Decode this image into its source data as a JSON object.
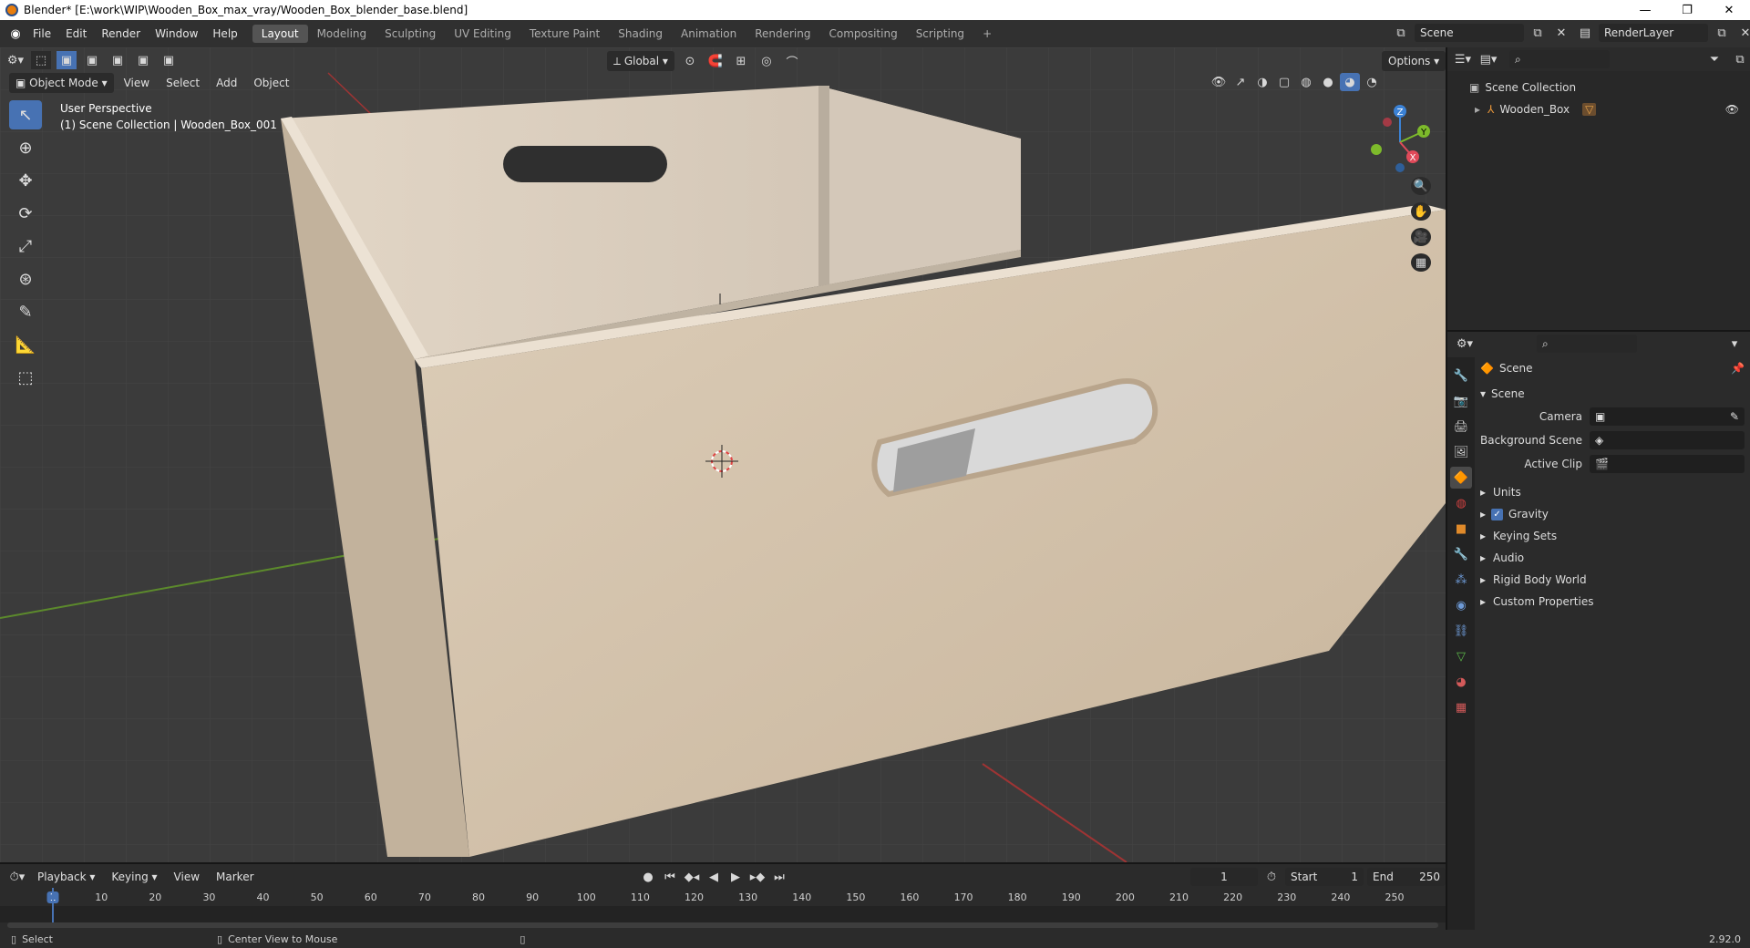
{
  "window": {
    "title": "Blender* [E:\\work\\WIP\\Wooden_Box_max_vray/Wooden_Box_blender_base.blend]",
    "min": "—",
    "max": "❐",
    "close": "✕"
  },
  "menu": [
    "File",
    "Edit",
    "Render",
    "Window",
    "Help"
  ],
  "workspaces": [
    "Layout",
    "Modeling",
    "Sculpting",
    "UV Editing",
    "Texture Paint",
    "Shading",
    "Animation",
    "Rendering",
    "Compositing",
    "Scripting"
  ],
  "active_workspace": "Layout",
  "scene_name": "Scene",
  "render_layer": "RenderLayer",
  "viewport": {
    "mode": "Object Mode",
    "menus": [
      "View",
      "Select",
      "Add",
      "Object"
    ],
    "transform_orientation": "Global",
    "options": "Options",
    "overlay_line1": "User Perspective",
    "overlay_line2": "(1) Scene Collection | Wooden_Box_001",
    "gizmo": {
      "z": "Z",
      "y": "Y",
      "x": "X"
    }
  },
  "outliner": {
    "root": "Scene Collection",
    "items": [
      {
        "label": "Wooden_Box"
      }
    ]
  },
  "properties": {
    "header": "Scene",
    "section": "Scene",
    "fields": [
      {
        "label": "Camera",
        "value": ""
      },
      {
        "label": "Background Scene",
        "value": ""
      },
      {
        "label": "Active Clip",
        "value": ""
      }
    ],
    "panels": [
      {
        "label": "Units",
        "checkbox": false
      },
      {
        "label": "Gravity",
        "checkbox": true
      },
      {
        "label": "Keying Sets",
        "checkbox": false
      },
      {
        "label": "Audio",
        "checkbox": false
      },
      {
        "label": "Rigid Body World",
        "checkbox": false
      },
      {
        "label": "Custom Properties",
        "checkbox": false
      }
    ]
  },
  "timeline": {
    "menus": [
      "Playback",
      "Keying",
      "View",
      "Marker"
    ],
    "current_frame": "1",
    "start_label": "Start",
    "start": "1",
    "end_label": "End",
    "end": "250",
    "ruler": [
      "1",
      "10",
      "20",
      "30",
      "40",
      "50",
      "60",
      "70",
      "80",
      "90",
      "100",
      "110",
      "120",
      "130",
      "140",
      "150",
      "160",
      "170",
      "180",
      "190",
      "200",
      "210",
      "220",
      "230",
      "240",
      "250"
    ]
  },
  "status": {
    "left": "Select",
    "middle": "Center View to Mouse",
    "version": "2.92.0"
  },
  "colors": {
    "accent": "#4772b3",
    "wood": "#d8c8b4",
    "grid": "#454545"
  }
}
